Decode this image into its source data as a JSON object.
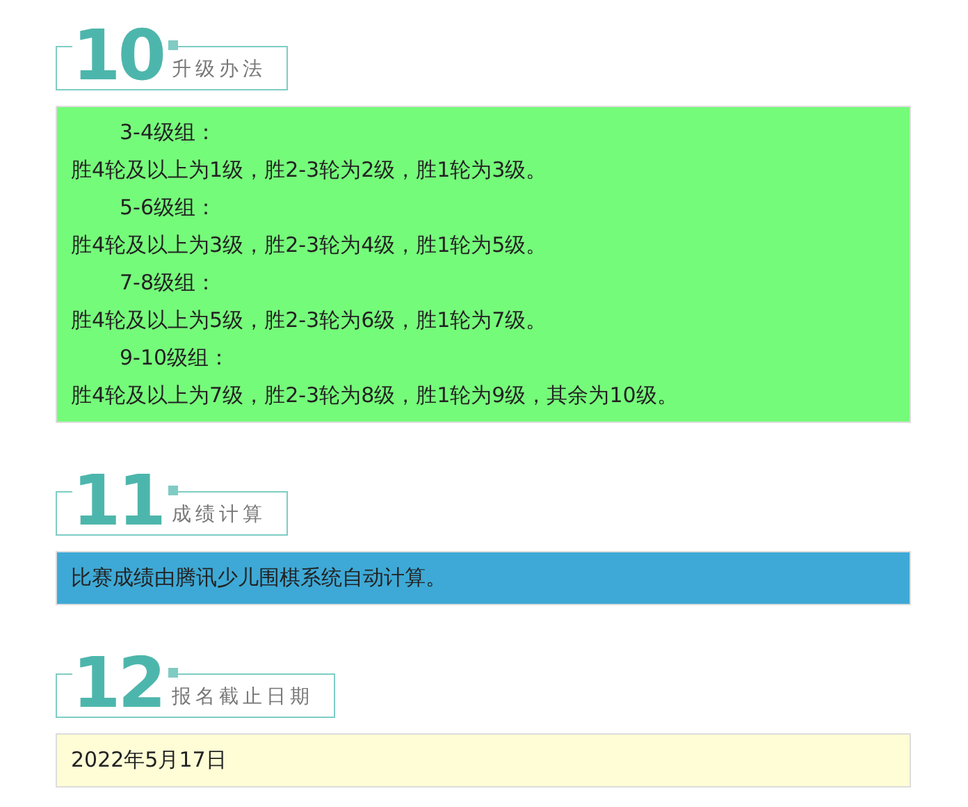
{
  "sections": [
    {
      "number": "10",
      "title": "升级办法",
      "color": "#75fb7a",
      "lines": [
        {
          "kind": "heading",
          "text": "3-4级组："
        },
        {
          "kind": "body",
          "text": "胜4轮及以上为1级，胜2-3轮为2级，胜1轮为3级。"
        },
        {
          "kind": "heading",
          "text": "5-6级组："
        },
        {
          "kind": "body",
          "text": "胜4轮及以上为3级，胜2-3轮为4级，胜1轮为5级。"
        },
        {
          "kind": "heading",
          "text": "7-8级组："
        },
        {
          "kind": "body",
          "text": "胜4轮及以上为5级，胜2-3轮为6级，胜1轮为7级。"
        },
        {
          "kind": "heading",
          "text": "9-10级组："
        },
        {
          "kind": "body",
          "text": "胜4轮及以上为7级，胜2-3轮为8级，胜1轮为9级，其余为10级。"
        }
      ]
    },
    {
      "number": "11",
      "title": "成绩计算",
      "color": "#3ea9d6",
      "lines": [
        {
          "kind": "body",
          "text": "比赛成绩由腾讯少儿围棋系统自动计算。"
        }
      ]
    },
    {
      "number": "12",
      "title": "报名截止日期",
      "color": "#fffdd6",
      "lines": [
        {
          "kind": "body",
          "text": "2022年5月17日"
        }
      ]
    }
  ]
}
